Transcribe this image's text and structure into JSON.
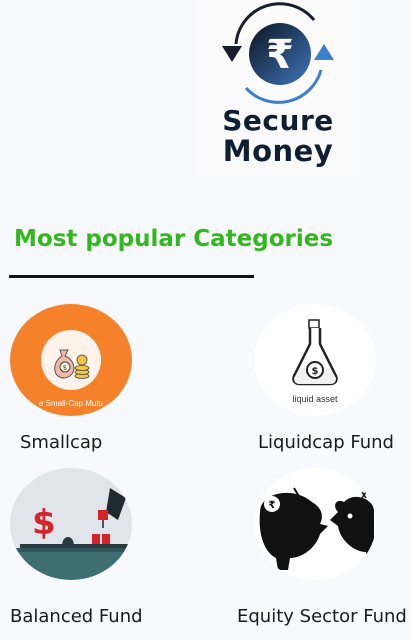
{
  "logo": {
    "line1": "Secure",
    "line2": "Money",
    "symbol": "₹",
    "icon": "rupee-exchange-icon"
  },
  "section": {
    "title": "Most popular Categories"
  },
  "categories": [
    {
      "label": "Smallcap",
      "image_caption": "e Small-Cap Mutu",
      "icon": "money-bag-coins-icon",
      "color": "#f5822b"
    },
    {
      "label": "Liquidcap Fund",
      "image_caption": "liquid asset",
      "icon": "flask-dollar-icon",
      "color": "#ffffff"
    },
    {
      "label": "Balanced Fund",
      "image_caption": "",
      "icon": "seesaw-dollar-icon",
      "color": "#dfe5ea"
    },
    {
      "label": "Equity Sector Fund",
      "image_caption": "",
      "icon": "piggy-banks-icon",
      "color": "#ffffff"
    }
  ],
  "colors": {
    "accent": "#32b81e",
    "background": "#f8f9fd",
    "logo_text": "#0e1f33",
    "logo_arrow": "#3a7fd0"
  }
}
